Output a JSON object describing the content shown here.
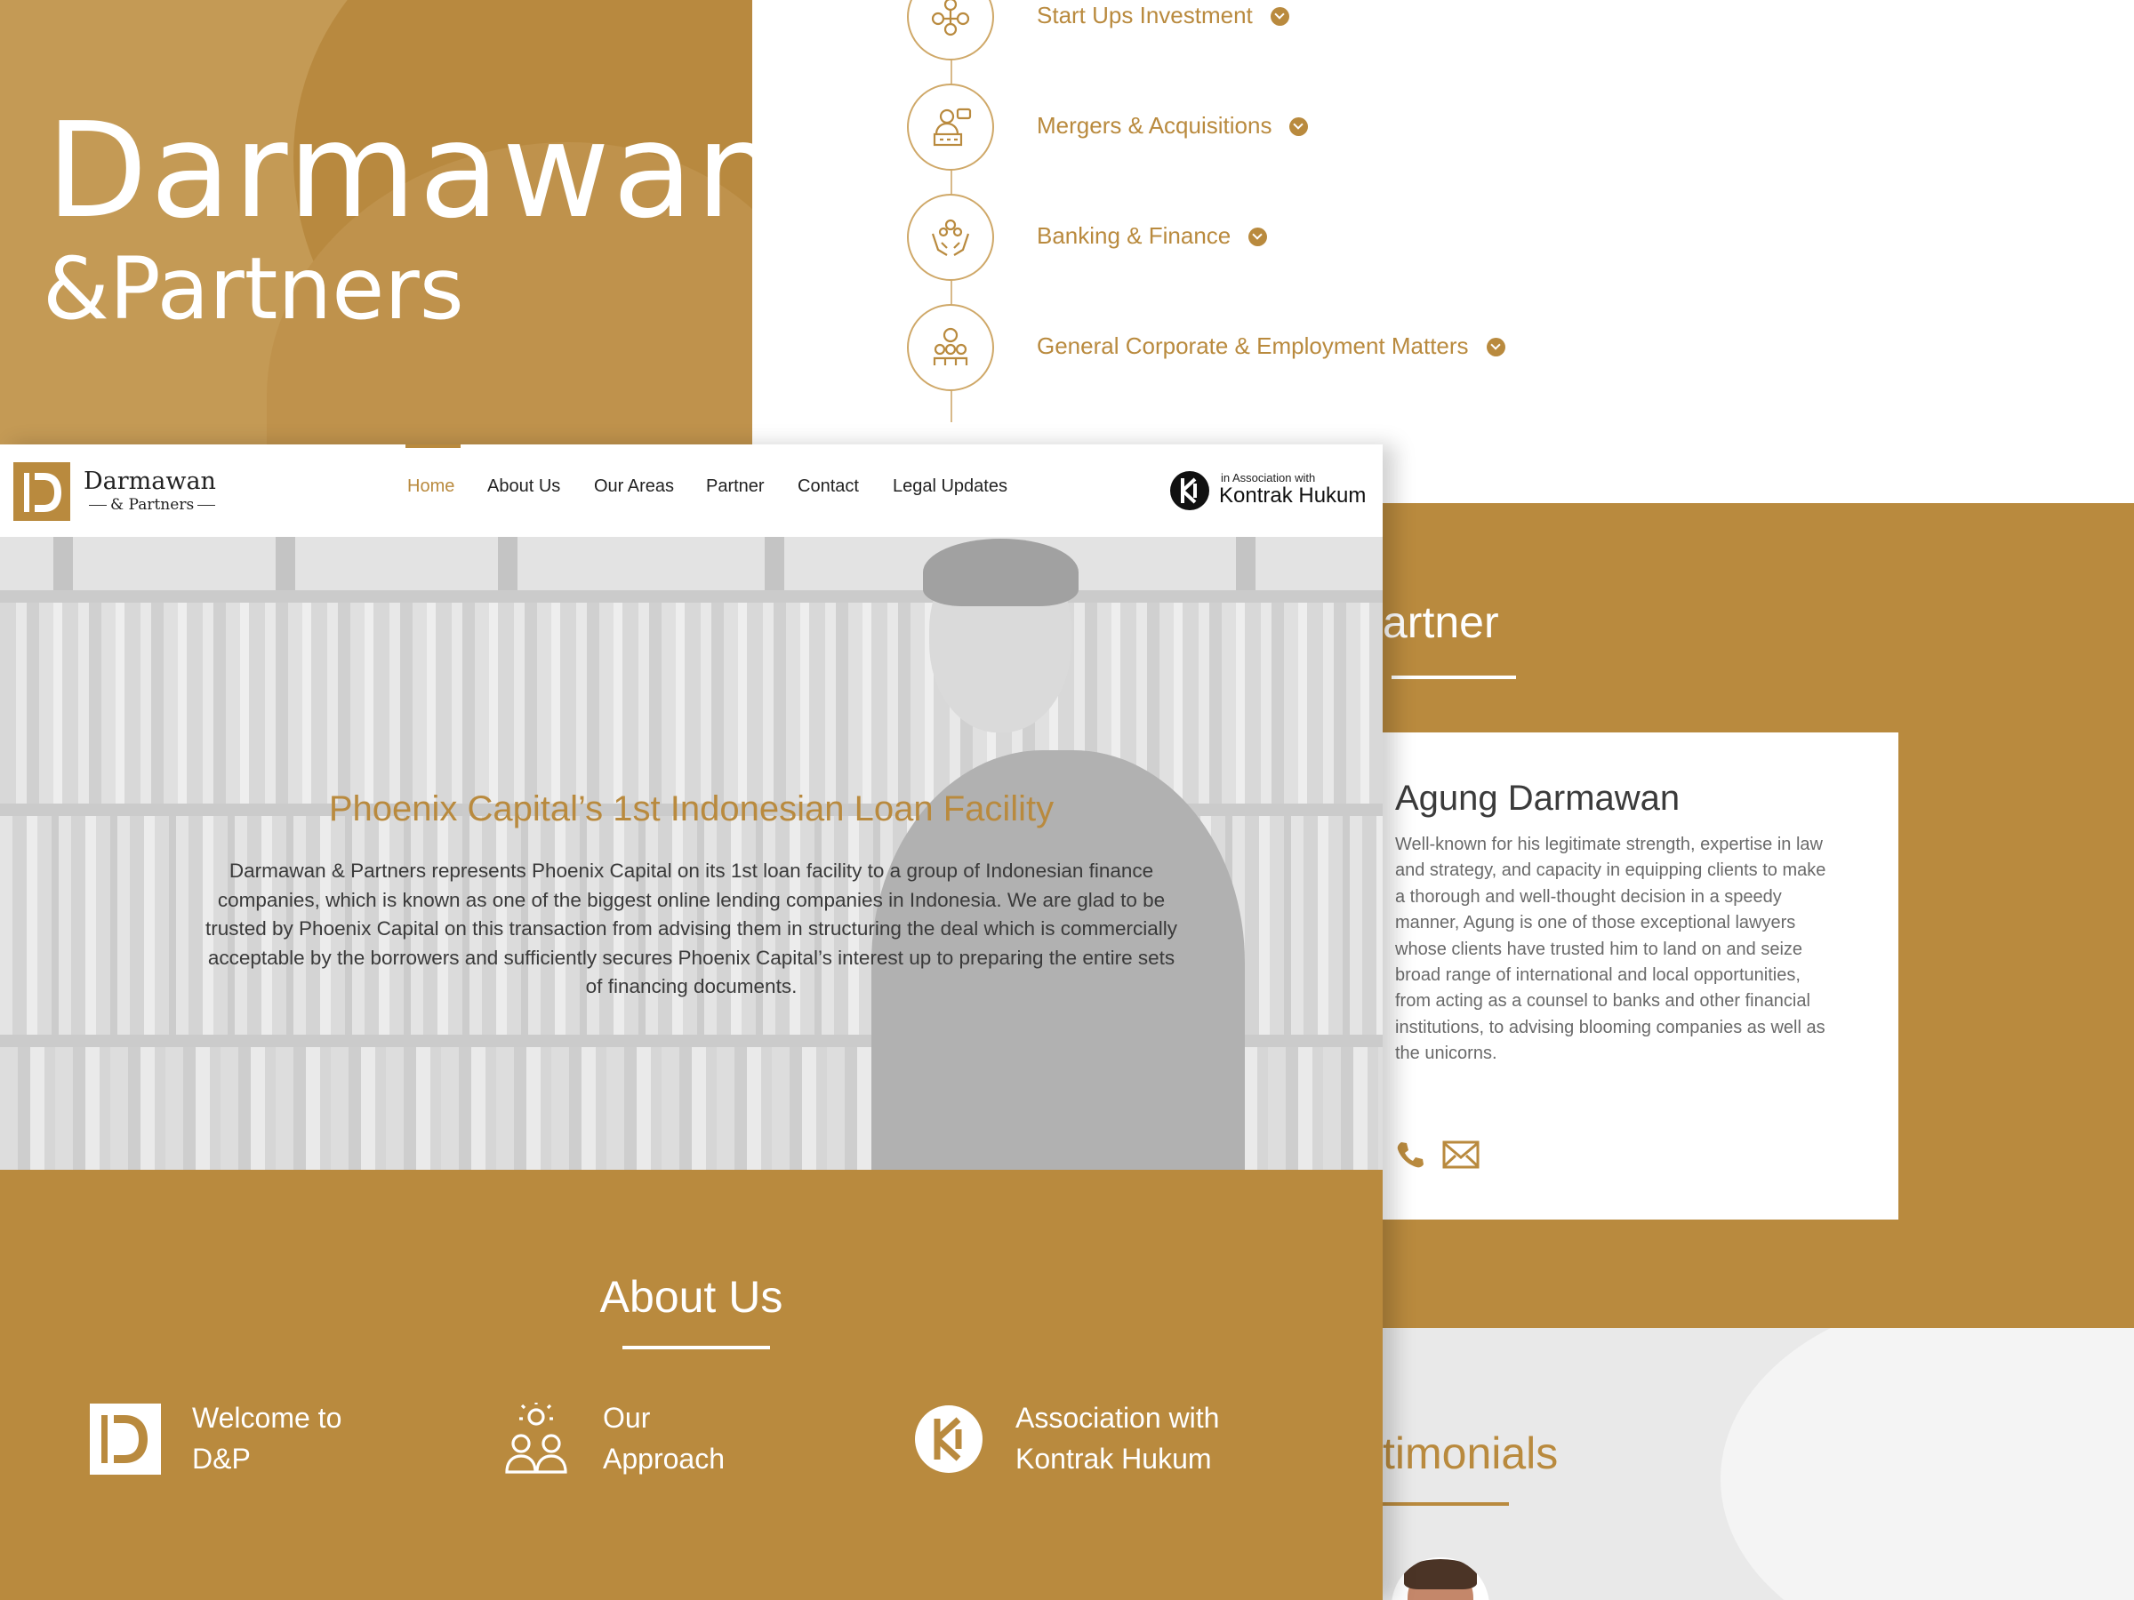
{
  "title_panel": {
    "brand": "Darmawan",
    "brand_sub": "&Partners"
  },
  "services": [
    {
      "label": "Start Ups Investment",
      "icon": "startup-network-icon"
    },
    {
      "label": "Mergers & Acquisitions",
      "icon": "handshake-desk-icon"
    },
    {
      "label": "Banking & Finance",
      "icon": "hands-coins-icon"
    },
    {
      "label": "General Corporate & Employment Matters",
      "icon": "team-gear-icon"
    }
  ],
  "navbar": {
    "logo_name": "Darmawan",
    "logo_sub": "& Partners",
    "items": [
      "Home",
      "About Us",
      "Our Areas",
      "Partner",
      "Contact",
      "Legal Updates"
    ],
    "active": "Home",
    "association_small": "in Association with",
    "association_big": "Kontrak Hukum"
  },
  "hero": {
    "title": "Phoenix Capital’s 1st Indonesian Loan Facility",
    "body": "Darmawan & Partners represents Phoenix Capital on its 1st loan facility to a group of Indonesian finance companies, which is known as one of the biggest online lending companies in Indonesia. We are glad to be trusted by Phoenix Capital on this transaction from advising them in structuring the deal which is commercially acceptable by the borrowers and sufficiently secures Phoenix Capital’s interest up to preparing the entire sets of financing documents.",
    "slides": 3,
    "active_slide": 1
  },
  "about": {
    "title": "About Us",
    "items": [
      {
        "line1": "Welcome to",
        "line2": "D&P"
      },
      {
        "line1": "Our",
        "line2": "Approach"
      },
      {
        "line1": "Association with",
        "line2": "Kontrak Hukum"
      }
    ]
  },
  "partner": {
    "title": "artner",
    "name": "Agung Darmawan",
    "bio": "Well-known for his legitimate strength, expertise in law and strategy, and capacity in equipping clients to make a thorough and well-thought decision in a speedy manner, Agung is one of those exceptional lawyers whose clients have trusted him to land on and seize broad range of international and local opportunities, from acting as a counsel to banks and other financial institutions, to advising blooming companies as well as the unicorns."
  },
  "testimonials": {
    "title": "timonials"
  },
  "colors": {
    "accent": "#b98a3e",
    "panel": "#c49a55",
    "white": "#ffffff"
  }
}
